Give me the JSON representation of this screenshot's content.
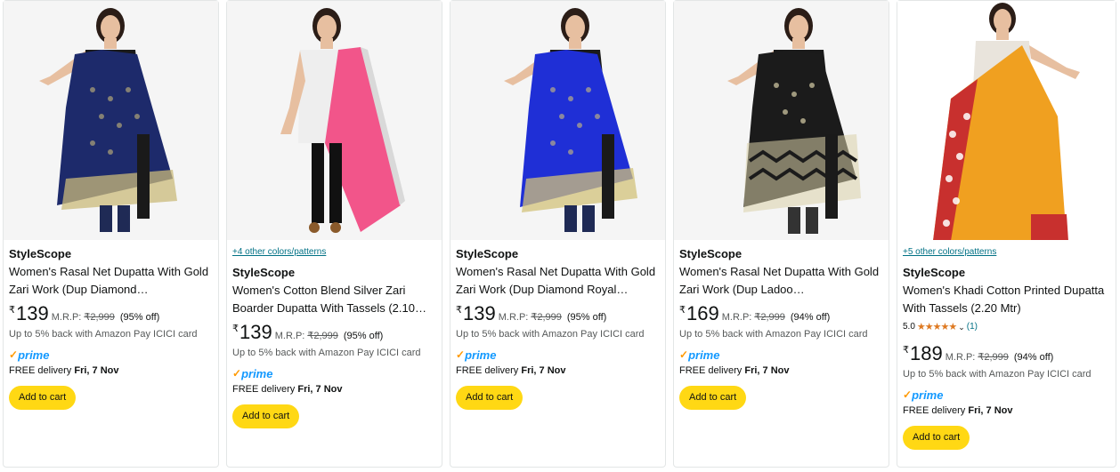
{
  "products": [
    {
      "colors_link": "",
      "brand": "StyleScope",
      "title": "Women's Rasal Net Dupatta With Gold Zari Work (Dup Diamond…",
      "rating_value": "",
      "rating_count": "",
      "currency": "₹",
      "price": "139",
      "mrp_label": "M.R.P:",
      "mrp": "₹2,999",
      "discount": "(95% off)",
      "cashback": "Up to 5% back with Amazon Pay ICICI card",
      "prime": "prime",
      "delivery_prefix": "FREE delivery ",
      "delivery_date": "Fri, 7 Nov",
      "add_to_cart": "Add to cart",
      "colors": {
        "dupatta": "#1d2a6b",
        "pattern": "#c9b97a",
        "top": "#1a1a1a"
      }
    },
    {
      "colors_link": "+4 other colors/patterns",
      "brand": "StyleScope",
      "title": "Women's Cotton Blend Silver Zari Boarder Dupatta With Tassels (2.10…",
      "rating_value": "",
      "rating_count": "",
      "currency": "₹",
      "price": "139",
      "mrp_label": "M.R.P:",
      "mrp": "₹2,999",
      "discount": "(95% off)",
      "cashback": "Up to 5% back with Amazon Pay ICICI card",
      "prime": "prime",
      "delivery_prefix": "FREE delivery ",
      "delivery_date": "Fri, 7 Nov",
      "add_to_cart": "Add to cart",
      "colors": {
        "dupatta": "#f2558a",
        "pattern": "#d9d9d9",
        "top": "#eeeeee"
      }
    },
    {
      "colors_link": "",
      "brand": "StyleScope",
      "title": "Women's Rasal Net Dupatta With Gold Zari Work (Dup Diamond Royal…",
      "rating_value": "",
      "rating_count": "",
      "currency": "₹",
      "price": "139",
      "mrp_label": "M.R.P:",
      "mrp": "₹2,999",
      "discount": "(95% off)",
      "cashback": "Up to 5% back with Amazon Pay ICICI card",
      "prime": "prime",
      "delivery_prefix": "FREE delivery ",
      "delivery_date": "Fri, 7 Nov",
      "add_to_cart": "Add to cart",
      "colors": {
        "dupatta": "#1f2fd6",
        "pattern": "#d1c27a",
        "top": "#1a1a1a"
      }
    },
    {
      "colors_link": "",
      "brand": "StyleScope",
      "title": "Women's Rasal Net Dupatta With Gold Zari Work (Dup Ladoo…",
      "rating_value": "",
      "rating_count": "",
      "currency": "₹",
      "price": "169",
      "mrp_label": "M.R.P:",
      "mrp": "₹2,999",
      "discount": "(94% off)",
      "cashback": "Up to 5% back with Amazon Pay ICICI card",
      "prime": "prime",
      "delivery_prefix": "FREE delivery ",
      "delivery_date": "Fri, 7 Nov",
      "add_to_cart": "Add to cart",
      "colors": {
        "dupatta": "#1b1b1b",
        "pattern": "#d8cfa8",
        "top": "#1a1a1a"
      }
    },
    {
      "colors_link": "+5 other colors/patterns",
      "brand": "StyleScope",
      "title": "Women's Khadi Cotton Printed Dupatta With Tassels (2.20 Mtr)",
      "rating_value": "5.0",
      "rating_count": "(1)",
      "stars": "★★★★★",
      "currency": "₹",
      "price": "189",
      "mrp_label": "M.R.P:",
      "mrp": "₹2,999",
      "discount": "(94% off)",
      "cashback": "Up to 5% back with Amazon Pay ICICI card",
      "prime": "prime",
      "delivery_prefix": "FREE delivery ",
      "delivery_date": "Fri, 7 Nov",
      "add_to_cart": "Add to cart",
      "colors": {
        "dupatta": "#f0a020",
        "pattern": "#c8302e",
        "top": "#e9e4dc"
      }
    }
  ]
}
